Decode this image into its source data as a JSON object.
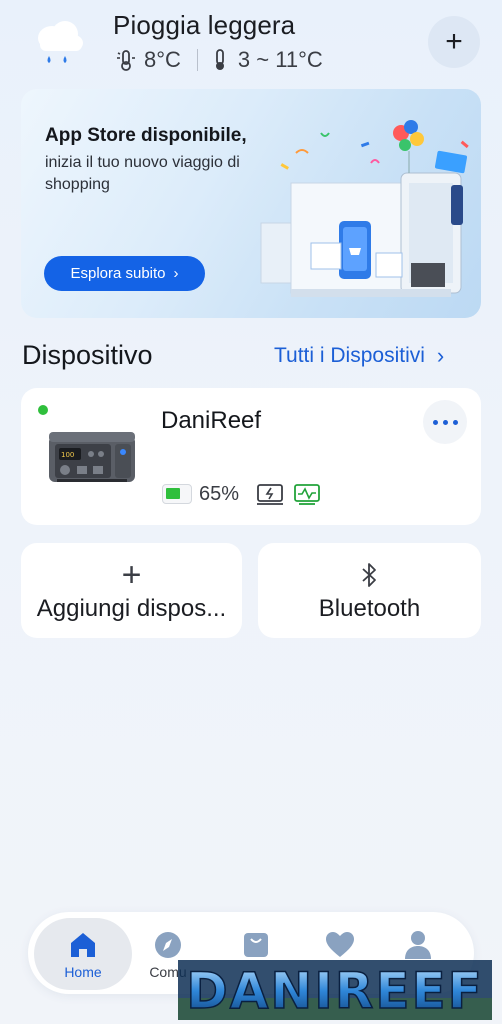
{
  "weather": {
    "condition": "Pioggia leggera",
    "current_temp": "8°C",
    "range": "3 ~ 11°C",
    "icon": "rain-cloud-icon",
    "add_button_label": "+"
  },
  "banner": {
    "title": "App Store disponibile,",
    "subtitle": "inizia il tuo nuovo viaggio di shopping",
    "cta": "Esplora subito",
    "cta_chevron": "›",
    "accent": "#1463e6"
  },
  "devices_section": {
    "title": "Dispositivo",
    "all_link": "Tutti i Dispositivi",
    "link_chevron": "›"
  },
  "device": {
    "name": "DaniReef",
    "online": true,
    "status_color": "#2fbf3c",
    "battery_percent_value": 65,
    "battery_label": "65%",
    "icons": [
      "ac-output-icon",
      "solar-input-icon"
    ]
  },
  "actions": {
    "add_device": "Aggiungi dispos...",
    "add_icon": "+",
    "bluetooth": "Bluetooth",
    "bluetooth_icon": "ᛒ"
  },
  "nav": {
    "home": "Home",
    "community": "Comu",
    "shop": "",
    "favorites": "",
    "me": "",
    "active": "home",
    "active_color": "#1c5fd6"
  },
  "watermark": {
    "text": "DANIREEF"
  }
}
